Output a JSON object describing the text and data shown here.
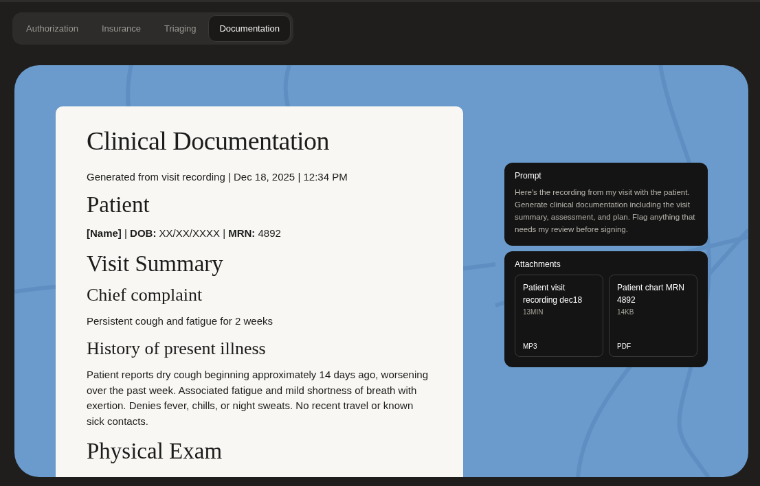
{
  "tabs": [
    {
      "label": "Authorization",
      "selected": false
    },
    {
      "label": "Insurance",
      "selected": false
    },
    {
      "label": "Triaging",
      "selected": false
    },
    {
      "label": "Documentation",
      "selected": true
    }
  ],
  "document": {
    "title": "Clinical Documentation",
    "blocks": [
      {
        "kind": "meta",
        "text": "Generated from visit recording | Dec 18, 2025 | 12:34 PM"
      },
      {
        "kind": "h2",
        "text": "Patient"
      },
      {
        "kind": "rich",
        "text": "**[Name]** | **DOB:** XX/XX/XXXX | **MRN:** 4892"
      },
      {
        "kind": "h2",
        "text": "Visit Summary"
      },
      {
        "kind": "h3",
        "text": "Chief complaint"
      },
      {
        "kind": "p",
        "text": "Persistent cough and fatigue for 2 weeks"
      },
      {
        "kind": "h3",
        "text": "History of present illness"
      },
      {
        "kind": "p",
        "text": "Patient reports dry cough beginning approximately 14 days ago, worsening over the past week. Associated fatigue and mild shortness of breath with exertion. Denies fever, chills, or night sweats. No recent travel or known sick contacts."
      },
      {
        "kind": "h2",
        "text": "Physical Exam"
      }
    ]
  },
  "prompt": {
    "title": "Prompt",
    "text": "Here's the recording from my visit with the patient. Generate clinical documentation including the visit summary, assessment, and plan. Flag anything that needs my review before signing."
  },
  "attachments": {
    "title": "Attachments",
    "files": [
      {
        "name": "Patient visit recording dec18",
        "size": "13MIN",
        "type": "MP3"
      },
      {
        "name": "Patient chart MRN 4892",
        "size": "14KB",
        "type": "PDF"
      }
    ]
  }
}
